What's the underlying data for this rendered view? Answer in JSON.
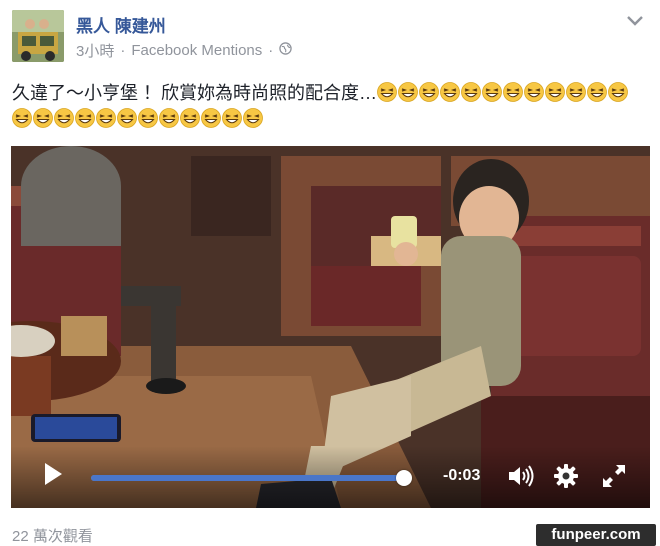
{
  "post": {
    "author": "黑人 陳建州",
    "time": "3小時",
    "separator": "·",
    "source": "Facebook Mentions",
    "separator2": "·",
    "text": "久違了～小亨堡 ！欣賞妳為時尚照的配合度…",
    "emoji_name": "grinning-squinting-face-icon",
    "emoji_count": 24
  },
  "video": {
    "time_remaining": "-0:03",
    "progress": 0.99
  },
  "footer": {
    "views": "22 萬次觀看"
  },
  "watermark": {
    "text": "funpeer.com"
  },
  "colors": {
    "author": "#365899",
    "meta": "#90949c",
    "progress_fill": "#4a76c9"
  }
}
